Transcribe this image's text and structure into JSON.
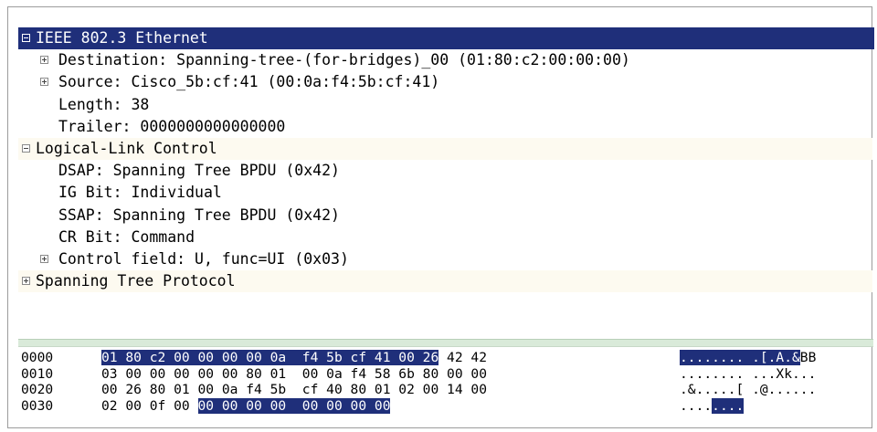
{
  "tree": [
    {
      "text": "IEEE 802.3 Ethernet",
      "indent": 0,
      "expander": "minus",
      "selected": true,
      "band": false
    },
    {
      "text": "Destination: Spanning-tree-(for-bridges)_00 (01:80:c2:00:00:00)",
      "indent": 1,
      "expander": "plus",
      "selected": false,
      "band": false
    },
    {
      "text": "Source: Cisco_5b:cf:41 (00:0a:f4:5b:cf:41)",
      "indent": 1,
      "expander": "plus",
      "selected": false,
      "band": false
    },
    {
      "text": "Length: 38",
      "indent": 1,
      "expander": "none",
      "selected": false,
      "band": false
    },
    {
      "text": "Trailer: 0000000000000000",
      "indent": 1,
      "expander": "none",
      "selected": false,
      "band": false
    },
    {
      "text": "Logical-Link Control",
      "indent": 0,
      "expander": "minus",
      "selected": false,
      "band": true
    },
    {
      "text": "DSAP: Spanning Tree BPDU (0x42)",
      "indent": 1,
      "expander": "none",
      "selected": false,
      "band": false
    },
    {
      "text": "IG Bit: Individual",
      "indent": 1,
      "expander": "none",
      "selected": false,
      "band": false
    },
    {
      "text": "SSAP: Spanning Tree BPDU (0x42)",
      "indent": 1,
      "expander": "none",
      "selected": false,
      "band": false
    },
    {
      "text": "CR Bit: Command",
      "indent": 1,
      "expander": "none",
      "selected": false,
      "band": false
    },
    {
      "text": "Control field: U, func=UI (0x03)",
      "indent": 1,
      "expander": "plus",
      "selected": false,
      "band": false
    },
    {
      "text": "Spanning Tree Protocol",
      "indent": 0,
      "expander": "plus",
      "selected": false,
      "band": true
    }
  ],
  "hex_dump": [
    {
      "offset": "0000",
      "bytes": [
        "01",
        "80",
        "c2",
        "00",
        "00",
        "00",
        "00",
        "0a",
        "f4",
        "5b",
        "cf",
        "41",
        "00",
        "26",
        "42",
        "42"
      ],
      "ascii": "........ .[.A.&BB",
      "hl_bytes": [
        0,
        14
      ],
      "hl_ascii": [
        0,
        15
      ]
    },
    {
      "offset": "0010",
      "bytes": [
        "03",
        "00",
        "00",
        "00",
        "00",
        "00",
        "80",
        "01",
        "00",
        "0a",
        "f4",
        "58",
        "6b",
        "80",
        "00",
        "00"
      ],
      "ascii": "........ ...Xk...",
      "hl_bytes": [
        0,
        0
      ],
      "hl_ascii": [
        0,
        0
      ]
    },
    {
      "offset": "0020",
      "bytes": [
        "00",
        "26",
        "80",
        "01",
        "00",
        "0a",
        "f4",
        "5b",
        "cf",
        "40",
        "80",
        "01",
        "02",
        "00",
        "14",
        "00"
      ],
      "ascii": ".&.....[ .@......",
      "hl_bytes": [
        0,
        0
      ],
      "hl_ascii": [
        0,
        0
      ]
    },
    {
      "offset": "0030",
      "bytes": [
        "02",
        "00",
        "0f",
        "00",
        "00",
        "00",
        "00",
        "00",
        "00",
        "00",
        "00",
        "00"
      ],
      "ascii": "........",
      "hl_bytes": [
        4,
        12
      ],
      "hl_ascii": [
        4,
        8
      ]
    }
  ],
  "colors": {
    "selection": "#1f2f7a",
    "band": "#fdfaf0",
    "splitter": "#d9ead9"
  }
}
